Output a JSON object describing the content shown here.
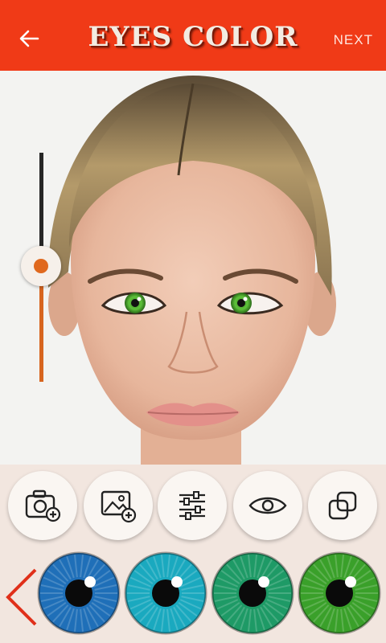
{
  "header": {
    "title": "EYES COLOR",
    "next_label": "NEXT",
    "bar_color": "#f03a17",
    "back_icon": "arrow-left-icon"
  },
  "slider": {
    "accent_color": "#e0691e",
    "value_fraction": 0.5
  },
  "tools": [
    {
      "name": "camera-add",
      "icon": "camera-plus-icon"
    },
    {
      "name": "gallery-add",
      "icon": "image-plus-icon"
    },
    {
      "name": "adjust",
      "icon": "sliders-icon"
    },
    {
      "name": "eye",
      "icon": "eye-icon"
    },
    {
      "name": "layers",
      "icon": "overlap-squares-icon"
    }
  ],
  "eye_colors": [
    {
      "name": "blue",
      "color": "#1f6fb8"
    },
    {
      "name": "cyan",
      "color": "#1aa9bf"
    },
    {
      "name": "teal-green",
      "color": "#1e9a66"
    },
    {
      "name": "green",
      "color": "#3aa02a"
    }
  ],
  "prev_icon": "chevron-left-icon"
}
